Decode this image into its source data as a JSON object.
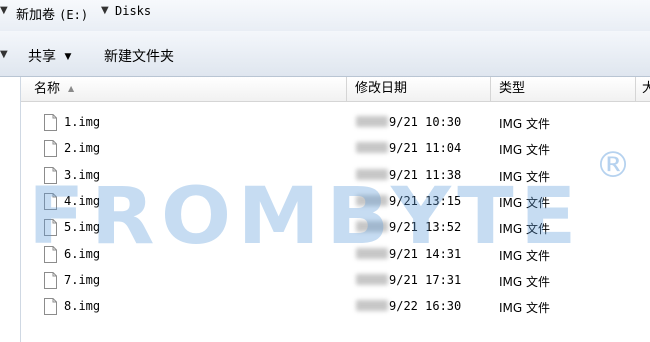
{
  "address_bar": {
    "arrow_left": "▼",
    "drive": "新加卷",
    "drive_letter": "(E:)",
    "arrow_sep": "▼",
    "folder": "Disks"
  },
  "toolbar": {
    "share_label": "共享",
    "share_arrow": "▼",
    "new_folder_label": "新建文件夹"
  },
  "columns": {
    "name": "名称",
    "modified": "修改日期",
    "type": "类型",
    "size": "大"
  },
  "files": [
    {
      "name": "1.img",
      "date": "9/21 10:30",
      "type": "IMG 文件"
    },
    {
      "name": "2.img",
      "date": "9/21 11:04",
      "type": "IMG 文件"
    },
    {
      "name": "3.img",
      "date": "9/21 11:38",
      "type": "IMG 文件"
    },
    {
      "name": "4.img",
      "date": "9/21 13:15",
      "type": "IMG 文件"
    },
    {
      "name": "5.img",
      "date": "9/21 13:52",
      "type": "IMG 文件"
    },
    {
      "name": "6.img",
      "date": "9/21 14:31",
      "type": "IMG 文件"
    },
    {
      "name": "7.img",
      "date": "9/21 17:31",
      "type": "IMG 文件"
    },
    {
      "name": "8.img",
      "date": "9/22 16:30",
      "type": "IMG 文件"
    }
  ],
  "watermark": {
    "text": "FROMBYTE",
    "registered": "®",
    "color": "#5e9ddc"
  },
  "colors": {
    "toolbar_top": "#f4f7fb",
    "toolbar_bottom": "#dfe6ef",
    "header_border": "#d5d5d5"
  }
}
